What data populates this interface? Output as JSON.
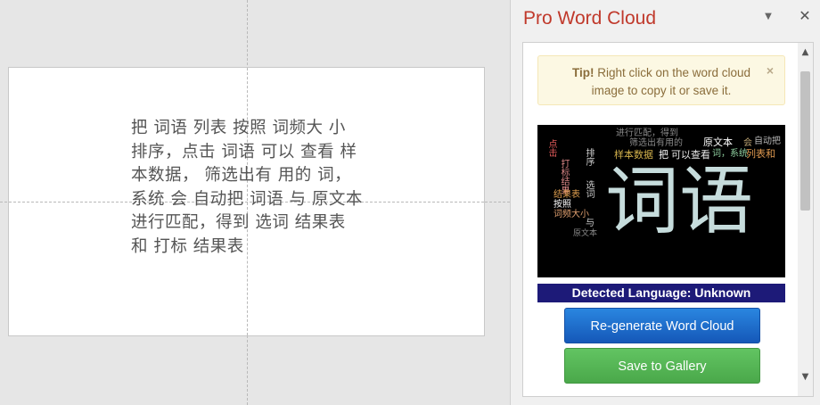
{
  "slide": {
    "text": "把 词语 列表 按照 词频大 小 排序，点击 词语 可以 查看 样本数据， 筛选出有 用的 词，系统 会 自动把 词语 与 原文本 进行匹配，得到 选词 结果表 和 打标 结果表"
  },
  "pane": {
    "title": "Pro Word Cloud",
    "menu_icon": "chevron-down-icon",
    "close_icon": "close-icon",
    "tip": {
      "label": "Tip!",
      "text": " Right click on the word cloud image to copy it or save it.",
      "close": "×"
    },
    "word_cloud": {
      "words": [
        {
          "text": "词语",
          "color": "#c6dcdc"
        },
        {
          "text": "进行匹配，得到",
          "color": "#8a8a8a"
        },
        {
          "text": "筛选出有用的",
          "color": "#8a8a8a"
        },
        {
          "text": "原文本",
          "color": "#ffffff"
        },
        {
          "text": "会",
          "color": "#b8a070"
        },
        {
          "text": "自动把",
          "color": "#b8b8b8"
        },
        {
          "text": "样本数据",
          "color": "#d4b24c"
        },
        {
          "text": "把",
          "color": "#ffffff"
        },
        {
          "text": "可以查看",
          "color": "#e6e6e6"
        },
        {
          "text": "词，系统",
          "color": "#8fd0a0"
        },
        {
          "text": "列表和",
          "color": "#e09a50"
        },
        {
          "text": "点击",
          "color": "#e05a5a"
        },
        {
          "text": "打标结果",
          "color": "#e08a8a"
        },
        {
          "text": "排序",
          "color": "#cfcfcf"
        },
        {
          "text": "选词",
          "color": "#cfcfcf"
        },
        {
          "text": "结果表",
          "color": "#e0a050"
        },
        {
          "text": "按照",
          "color": "#ffffff"
        },
        {
          "text": "词频大小",
          "color": "#e0a070"
        },
        {
          "text": "与",
          "color": "#cfcfcf"
        },
        {
          "text": "原文本",
          "color": "#8a8a8a"
        }
      ]
    },
    "detected_language": "Detected Language: Unknown",
    "regenerate_label": "Re-generate Word Cloud",
    "save_label": "Save to Gallery"
  }
}
